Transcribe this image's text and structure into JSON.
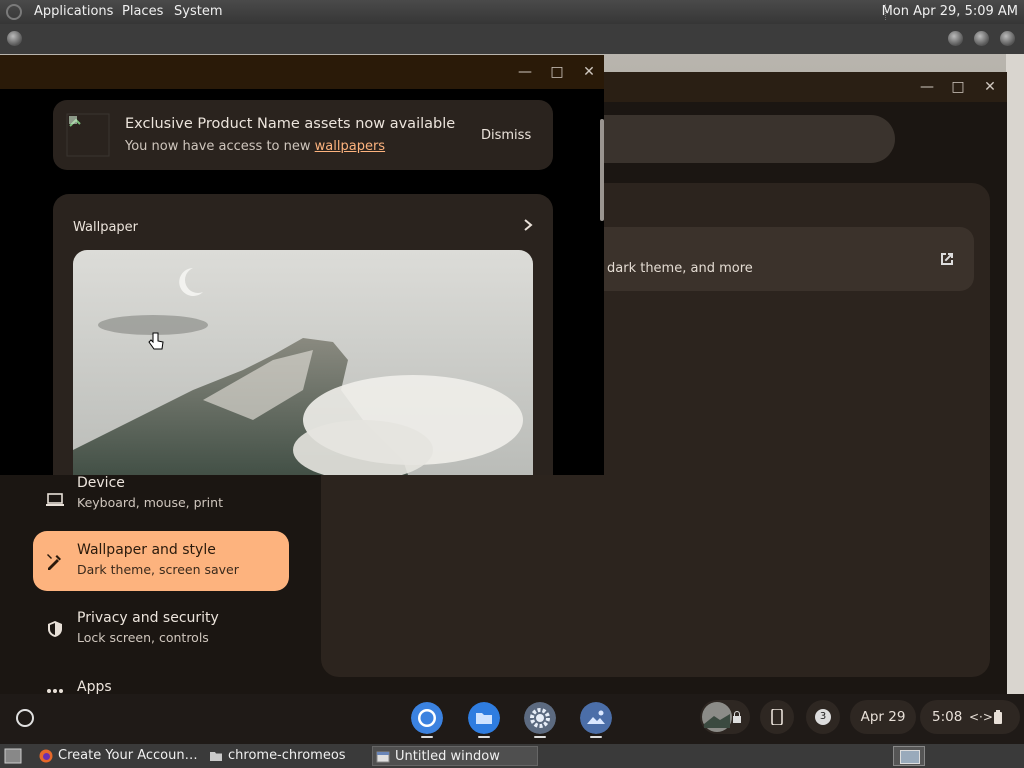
{
  "top_panel": {
    "menus": [
      "Applications",
      "Places",
      "System"
    ],
    "clock": "Mon Apr 29,  5:09 AM"
  },
  "settings": {
    "inner_card_text": "dark theme, and more",
    "nav": [
      {
        "title": "Device",
        "sub": "Keyboard, mouse, print",
        "icon": "laptop-icon"
      },
      {
        "title": "Wallpaper and style",
        "sub": "Dark theme, screen saver",
        "icon": "paint-brush-icon",
        "active": true
      },
      {
        "title": "Privacy and security",
        "sub": "Lock screen, controls",
        "icon": "shield-icon"
      },
      {
        "title": "Apps",
        "sub": "",
        "icon": "apps-dots-icon"
      }
    ],
    "accent": "#fdb37e"
  },
  "popup": {
    "banner_title": "Exclusive Product Name assets now available",
    "banner_sub_prefix": "You now have access to new ",
    "banner_link": "wallpapers",
    "dismiss": "Dismiss",
    "wallpaper_label": "Wallpaper"
  },
  "shelf": {
    "apps": [
      "chrome-icon",
      "files-icon",
      "settings-icon",
      "gallery-icon"
    ],
    "notification_count": "3",
    "date": "Apr 29",
    "time": "5:08"
  },
  "taskbar": {
    "tasks": [
      {
        "label": "Create Your Accoun…",
        "icon": "firefox-icon"
      },
      {
        "label": "chrome-chromeos",
        "icon": "folder-icon"
      },
      {
        "label": "Untitled window",
        "icon": "window-icon",
        "active": true
      }
    ]
  }
}
